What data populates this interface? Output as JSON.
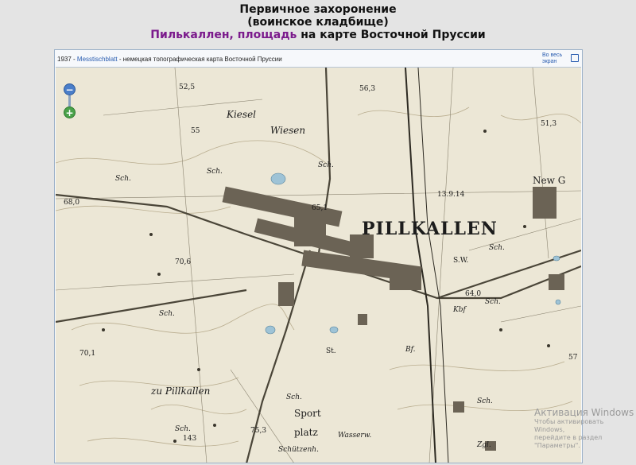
{
  "header": {
    "line1": "Первичное захоронение",
    "line2": "(воинское кладбище)",
    "place_link": "Пилькаллен, площадь",
    "line3_suffix": " на карте Восточной Пруссии"
  },
  "map": {
    "caption_year": "1937 - ",
    "caption_source": "Messtischblatt",
    "caption_rest": " - немецкая топографическая карта Восточной Пруссии",
    "fullscreen_line1": "Во весь",
    "fullscreen_line2": "экран",
    "zoom_out": "−",
    "zoom_in": "+",
    "labels": {
      "town": "PILLKALLEN",
      "kiesel": "Kiesel",
      "wiesen": "Wiesen",
      "new_g": "New G",
      "zu_pillkallen": "zu Pillkallen",
      "sport": "Sport",
      "platz": "platz",
      "wassert": "Wasserw.",
      "schutzenh": "Schützenh.",
      "sw": "S.W.",
      "bf": "Bf.",
      "kbf": "Kbf",
      "zgl": "Zgl.",
      "st": "St.",
      "sch1": "Sch.",
      "sch2": "Sch.",
      "sch3": "Sch.",
      "sch4": "Sch.",
      "sch5": "Sch.",
      "sch6": "Sch.",
      "sch7": "Sch.",
      "sch8": "Sch.",
      "sch9": "Sch.",
      "date_mark": "13.9.14",
      "elev_52": "52,5",
      "elev_55": "55",
      "elev_56": "56,3",
      "elev_68": "68,0",
      "elev_70": "70,6",
      "elev_70_1": "70,1",
      "elev_651": "65,1",
      "elev_64": "64,0",
      "elev_75": "75,3",
      "elev_143": "143",
      "elev_51": "51,3",
      "elev_57": "57"
    }
  },
  "watermark": {
    "title": "Активация Windows",
    "sub1": "Чтобы активировать Windows,",
    "sub2": "перейдите в раздел \"Параметры\"."
  }
}
